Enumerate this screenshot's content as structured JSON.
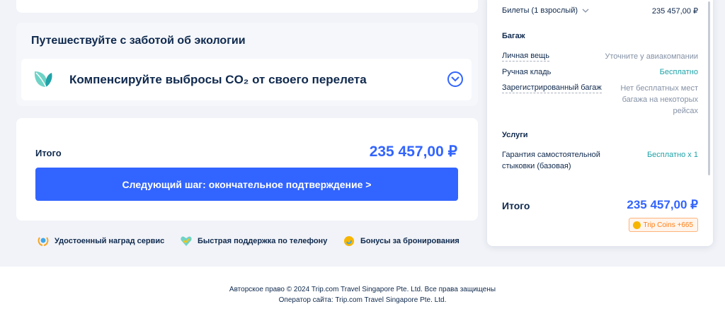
{
  "eco": {
    "title": "Путешествуйте с заботой об экологии",
    "offset_text": "Компенсируйте выбросы CO₂ от своего перелета"
  },
  "total": {
    "label": "Итого",
    "amount": "235 457,00 ₽",
    "next_button": "Следующий шаг: окончательное подтверждение >"
  },
  "benefits": [
    {
      "label": "Удостоенный наград сервис",
      "icon": "award-laurel-icon"
    },
    {
      "label": "Быстрая поддержка по телефону",
      "icon": "heart-check-icon"
    },
    {
      "label": "Бонусы за бронирования",
      "icon": "coin-bonus-icon"
    }
  ],
  "sidebar": {
    "tickets_label": "Билеты (1 взрослый)",
    "tickets_amount": "235 457,00 ₽",
    "baggage_title": "Багаж",
    "baggage": [
      {
        "label": "Личная вещь",
        "value": "Уточните у авиакомпании"
      },
      {
        "label": "Ручная кладь",
        "value": "Бесплатно"
      },
      {
        "label": "Зарегистрированный багаж",
        "value_lines": [
          "Нет бесплатных мест",
          "багажа на некоторых",
          "рейсах"
        ]
      }
    ],
    "services_title": "Услуги",
    "service": {
      "label_lines": [
        "Гарантия самостоятельной",
        "стыковки (базовая)"
      ],
      "value": "Бесплатно x 1"
    },
    "total_label": "Итого",
    "total_amount": "235 457,00 ₽",
    "coins": "Trip Coins +665"
  },
  "footer": {
    "copyright": "Авторское право © 2024 Trip.com Travel Singapore Pte. Ltd. Все права защищены",
    "operator": "Оператор сайта: Trip.com Travel Singapore Pte. Ltd."
  },
  "colors": {
    "accent": "#3264ff",
    "text": "#0f294d",
    "free": "#1fa3a8",
    "muted": "#8592a6",
    "coins": "#ff7d13"
  }
}
